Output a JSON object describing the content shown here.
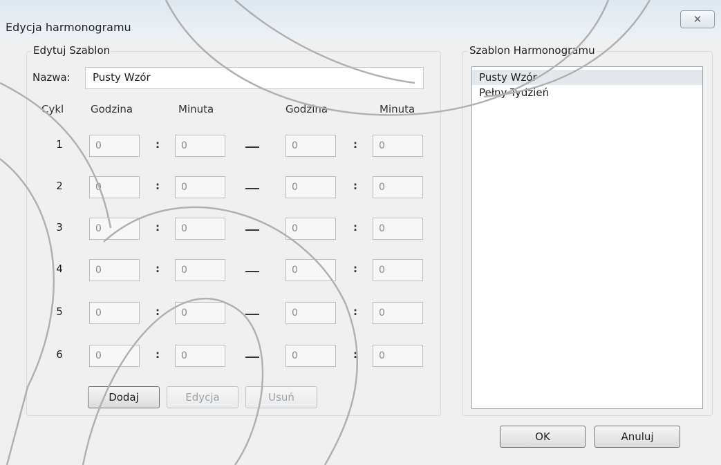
{
  "window": {
    "title": "Edycja harmonogramu",
    "close_glyph": "✕"
  },
  "edit_group": {
    "legend": "Edytuj Szablon",
    "name_label": "Nazwa:",
    "name_value": "Pusty Wzór"
  },
  "headers": {
    "cycle": "Cykl",
    "hour1": "Godzina",
    "minute1": "Minuta",
    "hour2": "Godzina",
    "minute2": "Minuta"
  },
  "cycles": [
    {
      "num": "1",
      "h1": "0",
      "m1": "0",
      "h2": "0",
      "m2": "0"
    },
    {
      "num": "2",
      "h1": "0",
      "m1": "0",
      "h2": "0",
      "m2": "0"
    },
    {
      "num": "3",
      "h1": "0",
      "m1": "0",
      "h2": "0",
      "m2": "0"
    },
    {
      "num": "4",
      "h1": "0",
      "m1": "0",
      "h2": "0",
      "m2": "0"
    },
    {
      "num": "5",
      "h1": "0",
      "m1": "0",
      "h2": "0",
      "m2": "0"
    },
    {
      "num": "6",
      "h1": "0",
      "m1": "0",
      "h2": "0",
      "m2": "0"
    }
  ],
  "buttons": {
    "add": "Dodaj",
    "edit": "Edycja",
    "delete": "Usuń",
    "ok": "OK",
    "cancel": "Anuluj"
  },
  "template_group": {
    "legend": "Szablon Harmonogramu",
    "items": [
      "Pusty Wzór",
      "Pełny Tydzień"
    ],
    "selected": "Pusty Wzór"
  }
}
